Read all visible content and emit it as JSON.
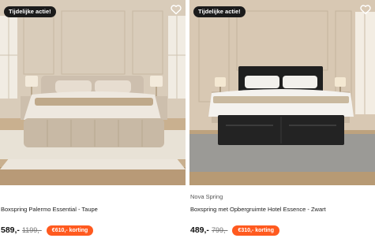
{
  "products": [
    {
      "badge": "Tijdelijke actie!",
      "brand": "",
      "title": "Boxspring Palermo Essential - Taupe",
      "price": "589,-",
      "old_price": "1199,-",
      "discount": "€610,- korting",
      "image": "beige-upholstered-bed-photo",
      "wishlist_icon": "heart-icon"
    },
    {
      "badge": "Tijdelijke actie!",
      "brand": "Nova Spring",
      "title": "Boxspring met Opbergruimte Hotel Essence - Zwart",
      "price": "489,-",
      "old_price": "799,-",
      "discount": "€310,- korting",
      "image": "black-boxspring-bed-photo",
      "wishlist_icon": "heart-icon"
    }
  ],
  "colors": {
    "badge_bg": "#1b1b1b",
    "discount_bg": "#ff5a1f"
  }
}
